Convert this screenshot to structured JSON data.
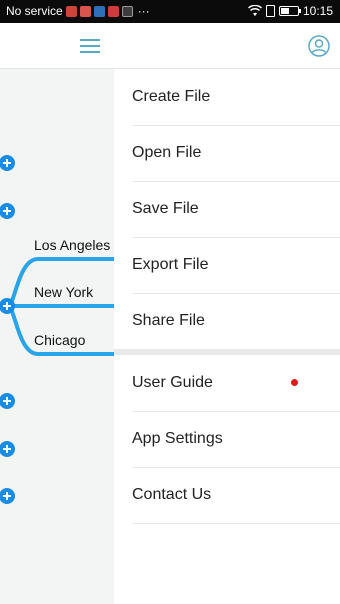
{
  "status_bar": {
    "carrier": "No service",
    "more": "···",
    "time": "10:15"
  },
  "mindmap": {
    "nodes": [
      "Los Angeles",
      "New York",
      "Chicago"
    ],
    "branch_color": "#29a4e8"
  },
  "drawer": {
    "file_items": [
      "Create File",
      "Open File",
      "Save File",
      "Export File",
      "Share File"
    ],
    "app_items": [
      "User Guide",
      "App Settings",
      "Contact Us"
    ]
  },
  "colors": {
    "accent": "#5aa9c4",
    "plus": "#1b8ce3",
    "notification_dot": "#e01b1b"
  }
}
